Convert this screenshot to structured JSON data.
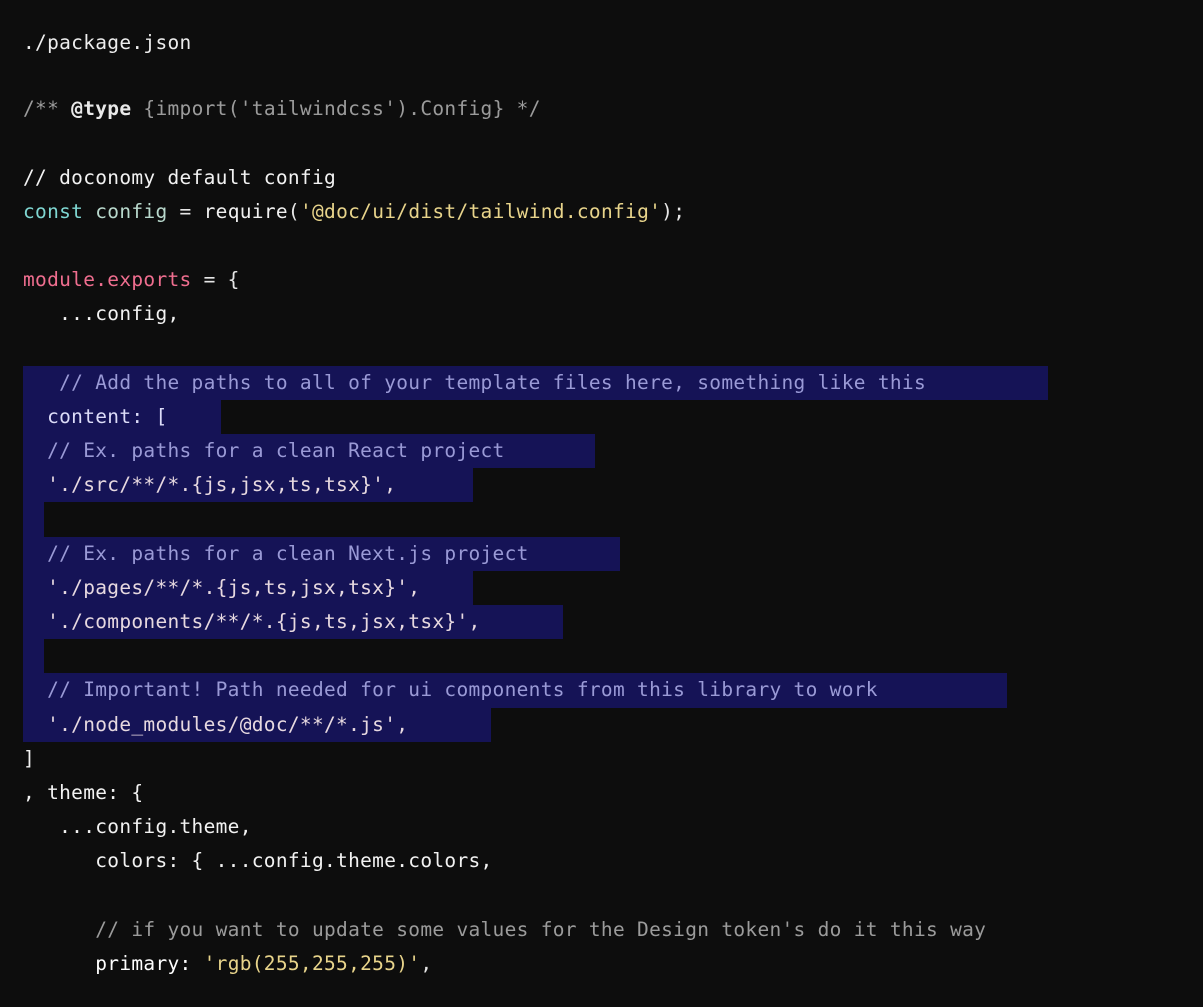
{
  "editor": {
    "background_color": "#0d0d0d",
    "selection_color": "#151356",
    "file_path": "./package.json",
    "language": "javascript"
  },
  "palette": {
    "text": "#f2f2f2",
    "comment_dim": "#9b9b9b",
    "keyword": "#7fd7d2",
    "string": "#e8d48b",
    "member": "#ef6e8f",
    "selection_text": "#9a9ad6"
  },
  "lines": [
    {
      "n": 1,
      "selected": false,
      "tokens": []
    },
    {
      "n": 2,
      "selected": false,
      "tokens": [
        {
          "cls": "t-jsdoc",
          "text": "/** "
        },
        {
          "cls": "t-jsdoc-tag",
          "text": "@type"
        },
        {
          "cls": "t-jsdoc",
          "text": " {import('tailwindcss').Config} */"
        }
      ]
    },
    {
      "n": 3,
      "selected": false,
      "tokens": []
    },
    {
      "n": 4,
      "selected": false,
      "tokens": [
        {
          "cls": "t-comment",
          "text": "// doconomy default config"
        }
      ]
    },
    {
      "n": 5,
      "selected": false,
      "tokens": [
        {
          "cls": "t-keyword",
          "text": "const"
        },
        {
          "cls": "t-var",
          "text": " config "
        },
        {
          "cls": "t-punct",
          "text": "= "
        },
        {
          "cls": "t-func",
          "text": "require"
        },
        {
          "cls": "t-punct",
          "text": "("
        },
        {
          "cls": "t-string",
          "text": "'@doc/ui/dist/tailwind.config'"
        },
        {
          "cls": "t-punct",
          "text": ");"
        }
      ]
    },
    {
      "n": 6,
      "selected": false,
      "tokens": []
    },
    {
      "n": 7,
      "selected": false,
      "tokens": [
        {
          "cls": "t-member",
          "text": "module.exports"
        },
        {
          "cls": "t-punct",
          "text": " = {"
        }
      ]
    },
    {
      "n": 8,
      "selected": false,
      "tokens": [
        {
          "cls": "t-plain",
          "text": "   ...config,"
        }
      ]
    },
    {
      "n": 9,
      "selected": false,
      "tokens": []
    },
    {
      "n": 10,
      "selected": true,
      "sel_width": 1025,
      "tokens": [
        {
          "cls": "t-comment-sel",
          "text": "   // Add the paths to all of your template files here, something like this"
        }
      ]
    },
    {
      "n": 11,
      "selected": true,
      "sel_width": 198,
      "tokens": [
        {
          "cls": "t-prop-sel",
          "text": "  content: ["
        }
      ]
    },
    {
      "n": 12,
      "selected": true,
      "sel_width": 572,
      "tokens": [
        {
          "cls": "t-comment-sel",
          "text": "  // Ex. paths for a clean React project"
        }
      ]
    },
    {
      "n": 13,
      "selected": true,
      "sel_width": 450,
      "tokens": [
        {
          "cls": "t-string-sel",
          "text": "  './src/**/*.{js,jsx,ts,tsx}',"
        }
      ]
    },
    {
      "n": 14,
      "selected": true,
      "sel_width": 21,
      "tokens": []
    },
    {
      "n": 15,
      "selected": true,
      "sel_width": 597,
      "tokens": [
        {
          "cls": "t-comment-sel",
          "text": "  // Ex. paths for a clean Next.js project"
        }
      ]
    },
    {
      "n": 16,
      "selected": true,
      "sel_width": 450,
      "tokens": [
        {
          "cls": "t-string-sel",
          "text": "  './pages/**/*.{js,ts,jsx,tsx}',"
        }
      ]
    },
    {
      "n": 17,
      "selected": true,
      "sel_width": 540,
      "tokens": [
        {
          "cls": "t-string-sel",
          "text": "  './components/**/*.{js,ts,jsx,tsx}',"
        }
      ]
    },
    {
      "n": 18,
      "selected": true,
      "sel_width": 21,
      "tokens": []
    },
    {
      "n": 19,
      "selected": true,
      "sel_width": 984,
      "tokens": [
        {
          "cls": "t-comment-sel",
          "text": "  // Important! Path needed for ui components from this library to work"
        }
      ]
    },
    {
      "n": 20,
      "selected": true,
      "sel_width": 468,
      "tokens": [
        {
          "cls": "t-string-sel",
          "text": "  './node_modules/@doc/**/*.js',"
        }
      ]
    },
    {
      "n": 21,
      "selected": false,
      "tokens": [
        {
          "cls": "t-plain",
          "text": "]"
        }
      ]
    },
    {
      "n": 22,
      "selected": false,
      "tokens": [
        {
          "cls": "t-plain",
          "text": ", theme: {"
        }
      ]
    },
    {
      "n": 23,
      "selected": false,
      "tokens": [
        {
          "cls": "t-plain",
          "text": "   ...config.theme,"
        }
      ]
    },
    {
      "n": 24,
      "selected": false,
      "tokens": [
        {
          "cls": "t-plain",
          "text": "      colors: { ...config.theme.colors,"
        }
      ]
    },
    {
      "n": 25,
      "selected": false,
      "tokens": []
    },
    {
      "n": 26,
      "selected": false,
      "tokens": [
        {
          "cls": "t-jsdoc",
          "text": "      // if you want to update some values for the Design token's do it this way"
        }
      ]
    },
    {
      "n": 27,
      "selected": false,
      "tokens": [
        {
          "cls": "t-prop",
          "text": "      primary: "
        },
        {
          "cls": "t-string",
          "text": "'rgb(255,255,255)'"
        },
        {
          "cls": "t-punct",
          "text": ","
        }
      ]
    }
  ]
}
